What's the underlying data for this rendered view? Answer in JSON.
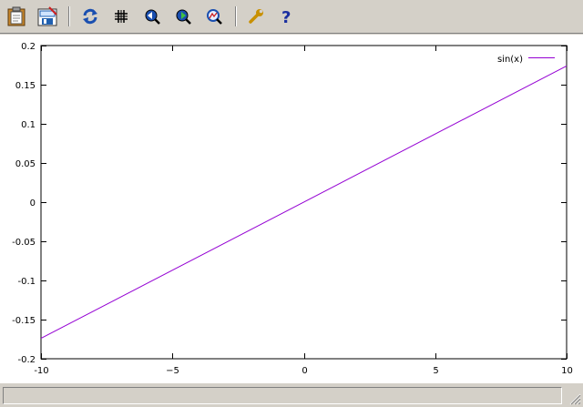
{
  "toolbar": {
    "buttons": [
      {
        "id": "copy",
        "icon": "clipboard-icon",
        "tooltip": ""
      },
      {
        "id": "print",
        "icon": "print-icon",
        "tooltip": ""
      },
      {
        "id": "replot",
        "icon": "replot-icon",
        "tooltip": ""
      },
      {
        "id": "grid",
        "icon": "grid-icon",
        "tooltip": ""
      },
      {
        "id": "zoom-prev",
        "icon": "zoom-previous-icon",
        "tooltip": ""
      },
      {
        "id": "zoom-next",
        "icon": "zoom-next-icon",
        "tooltip": ""
      },
      {
        "id": "autoscale",
        "icon": "autoscale-icon",
        "tooltip": ""
      },
      {
        "id": "options",
        "icon": "wrench-icon",
        "tooltip": ""
      },
      {
        "id": "help",
        "icon": "help-icon",
        "tooltip": ""
      }
    ]
  },
  "chart_data": {
    "type": "line",
    "title": "",
    "xlabel": "",
    "ylabel": "",
    "xlim": [
      -10,
      10
    ],
    "ylim": [
      -0.2,
      0.2
    ],
    "x_ticks": [
      -10,
      -5,
      0,
      5,
      10
    ],
    "x_tick_labels": [
      "-10",
      "−5",
      "0",
      "5",
      "10"
    ],
    "y_ticks": [
      -0.2,
      -0.15,
      -0.1,
      -0.05,
      0,
      0.05,
      0.1,
      0.15,
      0.2
    ],
    "y_tick_labels": [
      "-0.2",
      "-0.15",
      "-0.1",
      "-0.05",
      "0",
      "0.05",
      "0.1",
      "0.15",
      "0.2"
    ],
    "grid": false,
    "legend_position": "top-right",
    "series": [
      {
        "name": "sin(x)",
        "color": "#9400d3",
        "x": [
          -10,
          10
        ],
        "y": [
          -0.174,
          0.174
        ]
      }
    ]
  },
  "status": {
    "text": ""
  }
}
